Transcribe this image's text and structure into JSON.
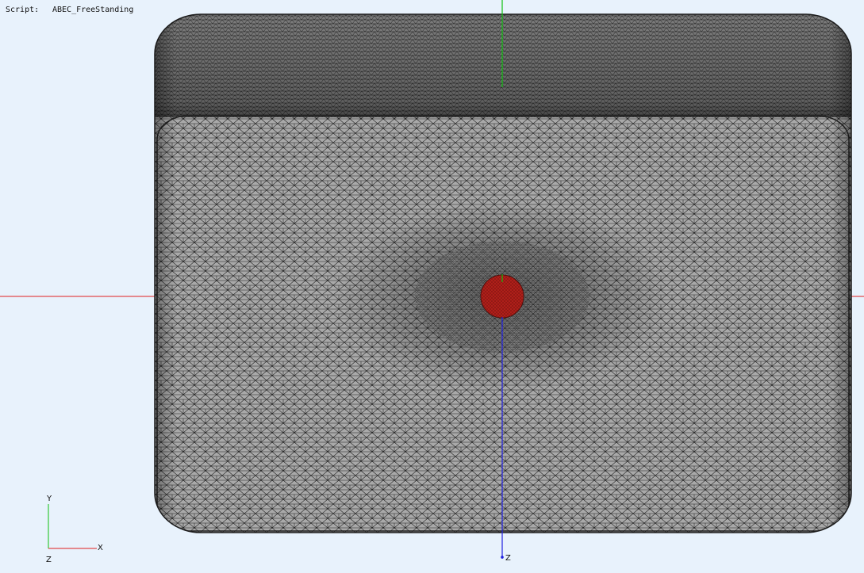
{
  "header": {
    "script_label": "Script:",
    "script_name": "ABEC_FreeStanding"
  },
  "axes_triad": {
    "y_label": "Y",
    "x_label": "X",
    "z_label": "Z"
  },
  "center_axis": {
    "z_label": "Z"
  },
  "colors": {
    "background": "#e8f2fc",
    "mesh_fill": "#a9a9a9",
    "mesh_lines": "#1a1a1a",
    "driver": "#b0201a",
    "x_axis": "#e02020",
    "y_axis": "#10c010",
    "z_axis": "#2020e0"
  }
}
